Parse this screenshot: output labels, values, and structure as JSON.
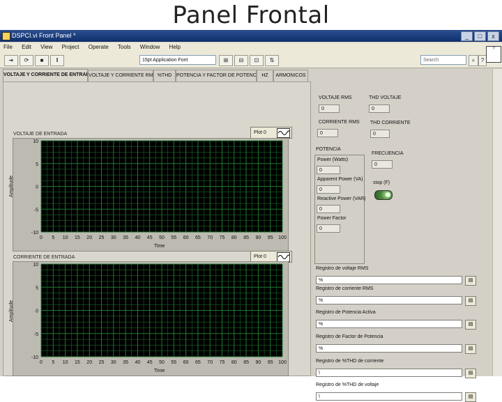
{
  "slide": {
    "title": "Panel Frontal"
  },
  "window": {
    "title": "DSPCI.vi Front Panel *",
    "min": "_",
    "max": "□",
    "close": "x"
  },
  "menu": [
    "File",
    "Edit",
    "View",
    "Project",
    "Operate",
    "Tools",
    "Window",
    "Help"
  ],
  "toolbar": {
    "font_select": "15pt Application Font",
    "search_placeholder": "Search",
    "help_badge": "?"
  },
  "tabs": [
    {
      "label": "VOLTAJE Y CORRIENTE DE ENTRADA",
      "active": true
    },
    {
      "label": "VOLTAJE Y CORRIENTE RMS"
    },
    {
      "label": "%THD"
    },
    {
      "label": "POTENCIA Y FACTOR DE POTENCIA"
    },
    {
      "label": "HZ"
    },
    {
      "label": "ARMONICOS"
    }
  ],
  "charts": [
    {
      "label": "VOLTAJE DE ENTRADA",
      "plot_button": "Plot 0",
      "ylabel": "Amplitude",
      "xlabel": "Time",
      "yticks": [
        "10",
        "5",
        "0",
        "-5",
        "-10"
      ],
      "xticks": [
        "0",
        "5",
        "10",
        "15",
        "20",
        "25",
        "30",
        "35",
        "40",
        "45",
        "50",
        "55",
        "60",
        "65",
        "70",
        "75",
        "80",
        "85",
        "90",
        "95",
        "100"
      ]
    },
    {
      "label": "CORRIENTE DE ENTRADA",
      "plot_button": "Plot 0",
      "ylabel": "Amplitude",
      "xlabel": "Time",
      "yticks": [
        "10",
        "5",
        "0",
        "-5",
        "-10"
      ],
      "xticks": [
        "0",
        "5",
        "10",
        "15",
        "20",
        "25",
        "30",
        "35",
        "40",
        "45",
        "50",
        "55",
        "60",
        "65",
        "70",
        "75",
        "80",
        "85",
        "90",
        "95",
        "100"
      ]
    }
  ],
  "indicators": {
    "voltaje_rms": {
      "label": "VOLTAJE RMS",
      "value": "0"
    },
    "thd_voltaje": {
      "label": "THD VOLTAJE",
      "value": "0"
    },
    "corriente_rms": {
      "label": "CORRIENTE RMS",
      "value": "0"
    },
    "thd_corriente": {
      "label": "THD CORRIENTE",
      "value": "0"
    },
    "frecuencia": {
      "label": "FRECUENCIA",
      "value": "0"
    },
    "stop_label": "stop (F)"
  },
  "potencia": {
    "label": "POTENCIA",
    "items": [
      {
        "label": "Power (Watts)",
        "value": "0"
      },
      {
        "label": "Apparent Power (VA)",
        "value": "0"
      },
      {
        "label": "Reactive Power (VAR)",
        "value": "0"
      },
      {
        "label": "Power Factor",
        "value": "0"
      }
    ]
  },
  "registros": [
    {
      "label": "Registro de voltaje RMS",
      "value": "%"
    },
    {
      "label": "Registro de corriente RMS",
      "value": "%"
    },
    {
      "label": "Registro de Potencia Activa",
      "value": "%"
    },
    {
      "label": "Registro de Factor de Potencia",
      "value": "%"
    },
    {
      "label": "Registro de %THD de corriente",
      "value": "\\"
    },
    {
      "label": "Registro de %THD de voltaje",
      "value": "\\"
    }
  ],
  "colors": {
    "plot_bg": "#000000",
    "grid": "#1f7a32",
    "panel": "#d4d0c8"
  }
}
